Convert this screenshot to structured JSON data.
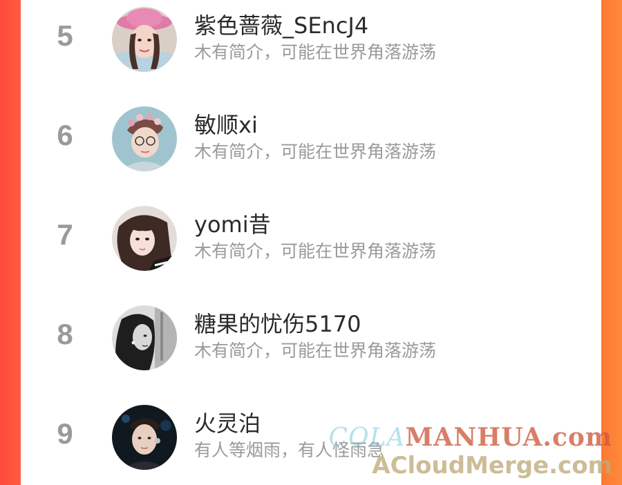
{
  "ranking": [
    {
      "rank": "5",
      "name": "紫色蔷薇_SEncJ4",
      "bio": "木有简介，可能在世界角落游荡",
      "avatar_icon": "avatar-woman-pink-hat"
    },
    {
      "rank": "6",
      "name": "敏顺xi",
      "bio": "木有简介，可能在世界角落游荡",
      "avatar_icon": "avatar-man-flower-crown"
    },
    {
      "rank": "7",
      "name": "yomi昔",
      "bio": "木有简介，可能在世界角落游荡",
      "avatar_icon": "avatar-girl-selfie"
    },
    {
      "rank": "8",
      "name": "糖果的忧伤5170",
      "bio": "木有简介，可能在世界角落游荡",
      "avatar_icon": "avatar-bw-portrait"
    },
    {
      "rank": "9",
      "name": "火灵泊",
      "bio": "有人等烟雨，有人怪雨急",
      "avatar_icon": "avatar-young-man-earpiece"
    }
  ],
  "watermark": {
    "line1_a": "COLA",
    "line1_b": "MANHUA.com",
    "line2": "ACloudMerge.com"
  },
  "colors": {
    "background_left": "#ff4a3c",
    "background_right": "#ff8a3a",
    "rank": "#9a9a9a",
    "name": "#2a2a2a",
    "bio": "#9a9a9a"
  }
}
